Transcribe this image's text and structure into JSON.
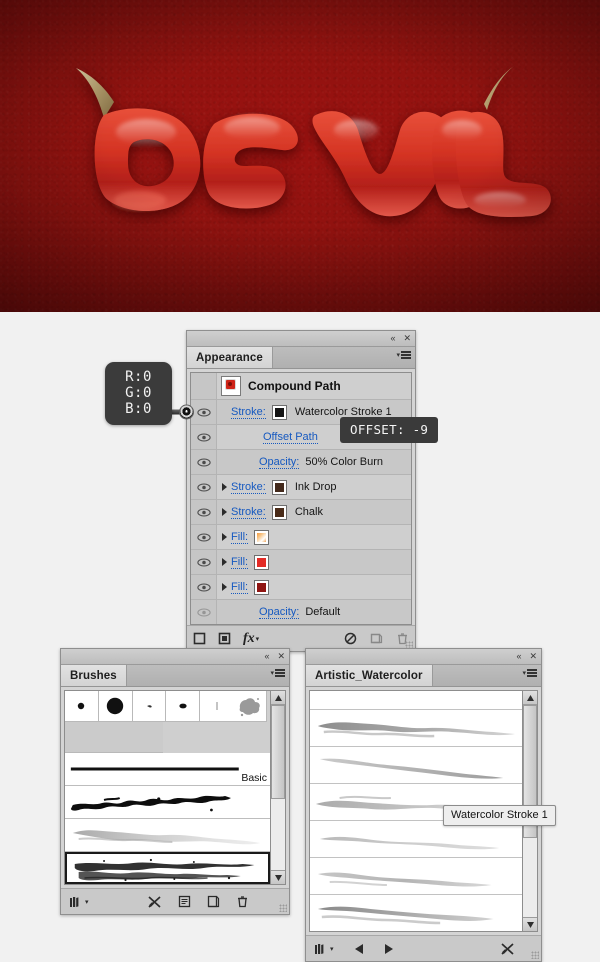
{
  "artwork": {
    "name": "devil-text-artwork",
    "word": "DEVIL",
    "background_color": "#8c120f",
    "letter_color": "#d83a28",
    "horn_color": "#b09a62"
  },
  "appearance_panel": {
    "title": "Appearance",
    "tab_label": "Appearance",
    "object_title": "Compound Path",
    "collapse_icon": "«",
    "close_icon": "✕",
    "rows": [
      {
        "label": "Stroke:",
        "value": "Watercolor Stroke 1",
        "swatch": "#141414",
        "has_swatch": true,
        "has_triangle": false,
        "eye": "visible-hidden",
        "targeted": true
      },
      {
        "label": "Offset Path",
        "value": "",
        "swatch": "",
        "has_swatch": false,
        "has_triangle": false,
        "eye": "visible",
        "targeted": false
      },
      {
        "label": "Opacity:",
        "value": "50% Color Burn",
        "swatch": "",
        "has_swatch": false,
        "has_triangle": false,
        "eye": "visible",
        "targeted": false
      },
      {
        "label": "Stroke:",
        "value": "Ink Drop",
        "swatch": "#43291b",
        "has_swatch": true,
        "has_triangle": true,
        "eye": "visible",
        "targeted": false
      },
      {
        "label": "Stroke:",
        "value": "Chalk",
        "swatch": "#4a2b18",
        "has_swatch": true,
        "has_triangle": true,
        "eye": "visible",
        "targeted": false
      },
      {
        "label": "Fill:",
        "value": "",
        "swatch": "gradient-orange",
        "has_swatch": true,
        "has_triangle": true,
        "eye": "visible",
        "targeted": false
      },
      {
        "label": "Fill:",
        "value": "",
        "swatch": "#e32b26",
        "has_swatch": true,
        "has_triangle": true,
        "eye": "visible",
        "targeted": false
      },
      {
        "label": "Fill:",
        "value": "",
        "swatch": "#8f1512",
        "has_swatch": true,
        "has_triangle": true,
        "eye": "visible",
        "targeted": false
      },
      {
        "label": "Opacity:",
        "value": "Default",
        "swatch": "",
        "has_swatch": false,
        "has_triangle": false,
        "eye": "dimmed",
        "targeted": false
      }
    ],
    "footer_icons": [
      "add-new-stroke-icon",
      "add-new-fill-icon",
      "add-effect-fx-icon",
      "clear-appearance-icon",
      "duplicate-item-icon",
      "delete-item-icon"
    ],
    "footer_fx_label": "fx"
  },
  "color_tooltip": {
    "name": "rgb-readout-tooltip",
    "r": "R:0",
    "g": "G:0",
    "b": "B:0"
  },
  "offset_tooltip": {
    "name": "offset-value-tooltip",
    "text": "OFFSET: -9"
  },
  "brushes_panel": {
    "title": "Brushes",
    "tab_label": "Brushes",
    "collapse_icon": "«",
    "close_icon": "✕",
    "grid_brushes": [
      "small-dot-brush",
      "large-dot-brush",
      "tiny-comma-brush",
      "oval-dot-brush",
      "thin-line-brush",
      "splatter-brush"
    ],
    "strip_brushes": [
      {
        "name": "Basic",
        "kind": "basic-line-brush",
        "selected": false
      },
      {
        "name": "",
        "kind": "ink-splatter-brush",
        "selected": false
      },
      {
        "name": "",
        "kind": "watercolor-wash-brush",
        "selected": false
      },
      {
        "name": "",
        "kind": "dry-charcoal-brush",
        "selected": true
      }
    ],
    "footer_icons": [
      "brush-libraries-icon",
      "remove-brush-stroke-icon",
      "brush-options-icon",
      "new-brush-icon",
      "delete-brush-icon"
    ]
  },
  "watercolor_panel": {
    "title": "Artistic_Watercolor",
    "tab_label": "Artistic_Watercolor",
    "collapse_icon": "«",
    "close_icon": "✕",
    "strokes": [
      "watercolor-stroke-1",
      "watercolor-stroke-2",
      "watercolor-stroke-3",
      "watercolor-stroke-4",
      "watercolor-stroke-5",
      "watercolor-stroke-6"
    ],
    "footer_icons": [
      "brush-libraries-icon",
      "load-previous-library-icon",
      "load-next-library-icon",
      "remove-brush-stroke-icon"
    ]
  },
  "brush_tooltip": {
    "name": "watercolor-stroke-tooltip",
    "text": "Watercolor Stroke 1"
  }
}
